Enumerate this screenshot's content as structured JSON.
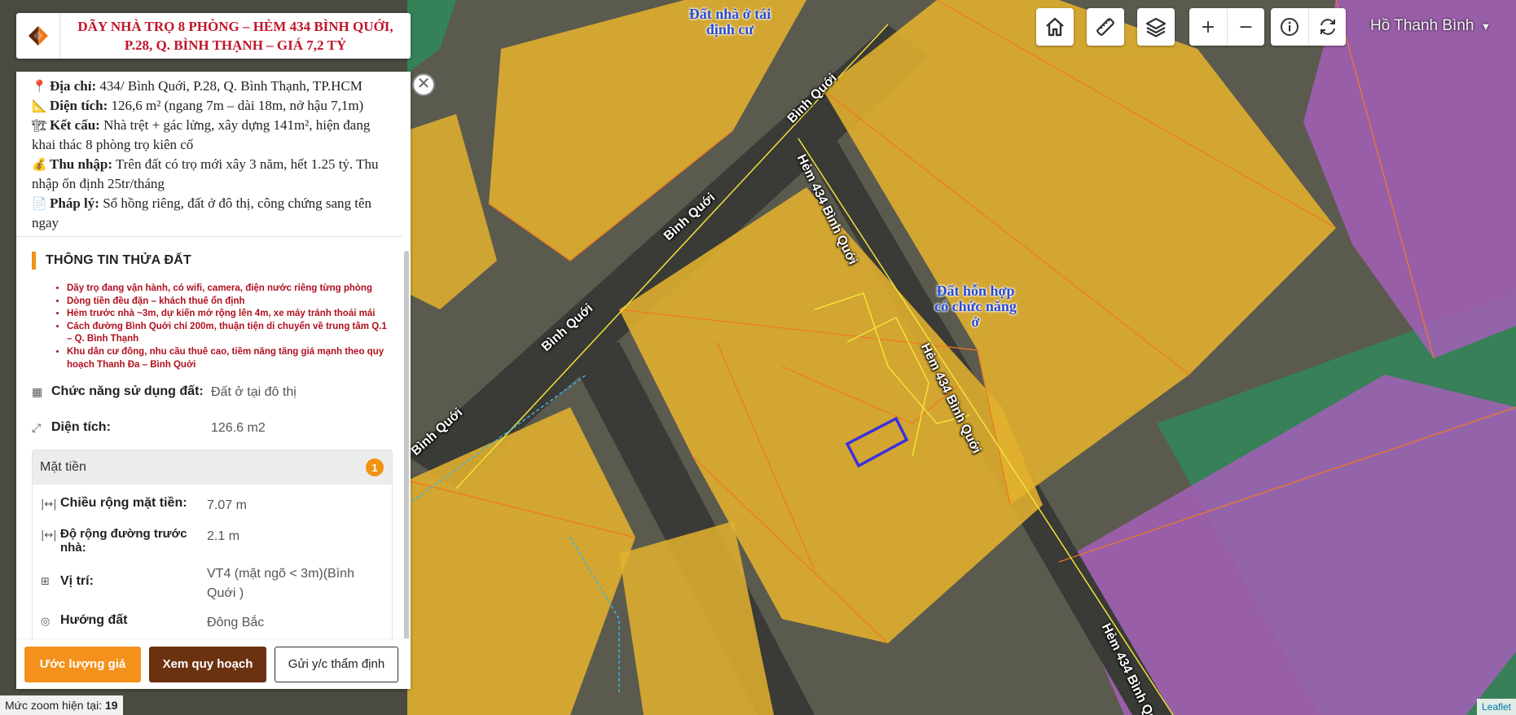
{
  "title": "DÃY NHÀ TRỌ 8 PHÒNG – HẺM 434 BÌNH QUỚI, P.28, Q. BÌNH THẠNH – GIÁ 7,2 TỶ",
  "description": [
    {
      "icon": "📍",
      "label": "Địa chỉ:",
      "value": "434/ Bình Quới, P.28, Q. Bình Thạnh, TP.HCM"
    },
    {
      "icon": "📐",
      "label": "Diện tích:",
      "value": "126,6 m² (ngang 7m – dài 18m, nở hậu 7,1m)"
    },
    {
      "icon": "🏗",
      "label": "Kết cấu:",
      "value": "Nhà trệt + gác lửng, xây dựng 141m², hiện đang khai thác 8 phòng trọ kiên cố"
    },
    {
      "icon": "💰",
      "label": "Thu nhập:",
      "value": "Trên đất có trọ mới xây 3 năm, hết 1.25 tỷ. Thu nhập ổn định 25tr/tháng"
    },
    {
      "icon": "📄",
      "label": "Pháp lý:",
      "value": "Sổ hồng riêng, đất ở đô thị, công chứng sang tên ngay"
    }
  ],
  "section_title": "THÔNG TIN THỬA ĐẤT",
  "bullets": [
    "Dãy trọ đang vận hành, có wifi, camera, điện nước riêng từng phòng",
    "Dòng tiền đều đặn – khách thuê ổn định",
    "Hẻm trước nhà ~3m, dự kiến mở rộng lên 4m, xe máy tránh thoải mái",
    "Cách đường Bình Quới chỉ 200m, thuận tiện di chuyển về trung tâm Q.1 – Q. Bình Thạnh",
    "Khu dân cư đông, nhu cầu thuê cao, tiềm năng tăng giá mạnh theo quy hoạch Thanh Đa – Bình Quới"
  ],
  "land_use": {
    "label": "Chức năng sử dụng đất:",
    "value": "Đất ở tại đô thị"
  },
  "area": {
    "label": "Diện tích:",
    "value": "126.6 m2"
  },
  "frontage": {
    "title": "Mặt tiền",
    "count": "1",
    "rows": [
      {
        "label": "Chiều rộng mặt tiền:",
        "value": "7.07 m"
      },
      {
        "label": "Độ rộng đường trước nhà:",
        "value": "2.1 m"
      },
      {
        "label": "Vị trí:",
        "value": "VT4 (mặt ngõ < 3m)(Bình Quới )"
      },
      {
        "label": "Hướng đất",
        "value": "Đông Bắc"
      }
    ]
  },
  "actions": {
    "estimate": "Ước lượng giá",
    "planning": "Xem quy hoạch",
    "appraisal": "Gửi y/c thẩm định"
  },
  "close_symbol": "✕",
  "user_name": "Hồ Thanh Bình",
  "zoom": {
    "label": "Mức zoom hiện tại:",
    "value": "19"
  },
  "attribution": "Leaflet",
  "map": {
    "zones": [
      {
        "text": "Đất nhà ở tái định cư"
      },
      {
        "text": "Đất hỗn hợp có chức năng ở"
      }
    ],
    "streets": [
      "Bình Quới",
      "Bình Quới",
      "Bình Quới",
      "Bình Quới",
      "Hẻm 434 Bình Quới",
      "Hẻm 434 Bình Quới",
      "Hẻm 434 Bình Quới"
    ]
  },
  "colors": {
    "residential_zone": "#e3b12e",
    "mixed_zone": "#e3b12e",
    "park_zone": "#a45fb8",
    "green_zone": "#2f8a5a",
    "parcel_highlight": "#3b2fe0",
    "accent": "#f39214",
    "title_red": "#c0162a"
  }
}
